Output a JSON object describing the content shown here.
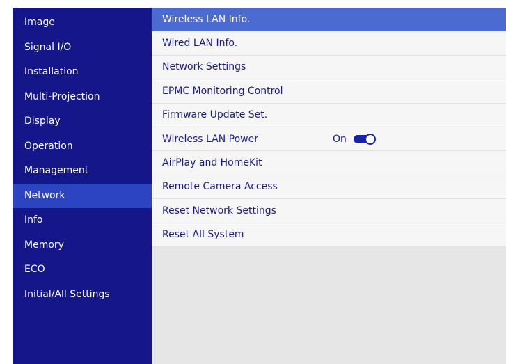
{
  "sidebar": {
    "items": [
      {
        "label": "Image"
      },
      {
        "label": "Signal I/O"
      },
      {
        "label": "Installation"
      },
      {
        "label": "Multi-Projection"
      },
      {
        "label": "Display"
      },
      {
        "label": "Operation"
      },
      {
        "label": "Management"
      },
      {
        "label": "Network"
      },
      {
        "label": "Info"
      },
      {
        "label": "Memory"
      },
      {
        "label": "ECO"
      },
      {
        "label": "Initial/All Settings"
      }
    ],
    "active": "Network"
  },
  "network_menu": {
    "items": [
      {
        "label": "Wireless LAN Info."
      },
      {
        "label": "Wired LAN Info."
      },
      {
        "label": "Network Settings"
      },
      {
        "label": "EPMC Monitoring Control"
      },
      {
        "label": "Firmware Update Set."
      },
      {
        "label": "Wireless LAN Power",
        "value": "On"
      },
      {
        "label": "AirPlay and HomeKit"
      },
      {
        "label": "Remote Camera Access"
      },
      {
        "label": "Reset Network Settings"
      },
      {
        "label": "Reset All System"
      }
    ],
    "selected": "Wireless LAN Info."
  },
  "colors": {
    "sidebar_bg": "#14168a",
    "sidebar_active": "#2d44c1",
    "selected_row": "#4c6bd0",
    "row_text": "#1a1a8c",
    "content_bg": "#e6e6e6"
  }
}
